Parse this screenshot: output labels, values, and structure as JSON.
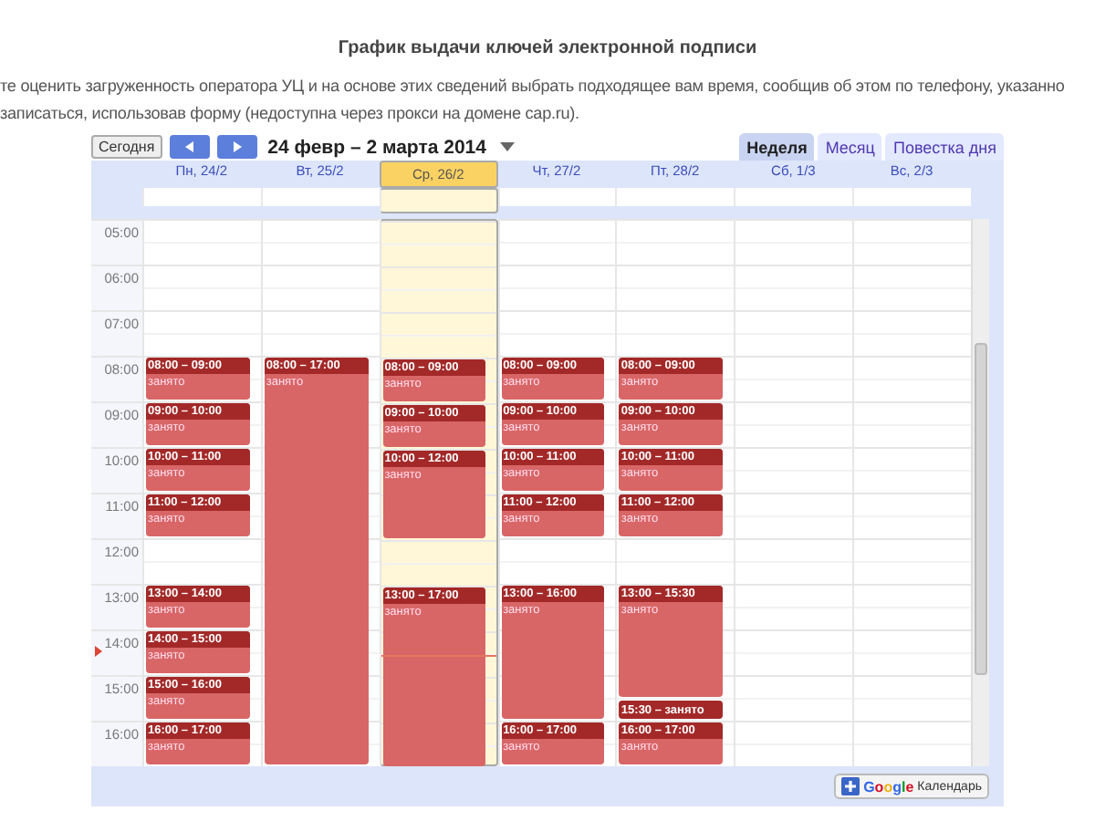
{
  "page": {
    "title": "График выдачи ключей электронной подписи",
    "paragraph_lines": [
      "те оценить загруженность оператора УЦ и на основе этих сведений выбрать подходящее вам время, сообщив об этом по телефону, указанно",
      "записаться, использовав форму (недоступна через прокси на домене cap.ru)."
    ]
  },
  "calendar": {
    "today_button": "Сегодня",
    "date_range": "24 февр – 2 марта 2014",
    "view_tabs": [
      {
        "label": "Неделя",
        "selected": true
      },
      {
        "label": "Месяц",
        "selected": false
      },
      {
        "label": "Повестка дня",
        "selected": false
      }
    ],
    "hours": [
      "05:00",
      "06:00",
      "07:00",
      "08:00",
      "09:00",
      "10:00",
      "11:00",
      "12:00",
      "13:00",
      "14:00",
      "15:00",
      "16:00"
    ],
    "days": [
      {
        "label": "Пн, 24/2",
        "selected": false,
        "events": [
          {
            "kind": "block",
            "time": "08:00 – 09:00",
            "title": "занято"
          },
          {
            "kind": "block",
            "time": "09:00 – 10:00",
            "title": "занято"
          },
          {
            "kind": "block",
            "time": "10:00 – 11:00",
            "title": "занято"
          },
          {
            "kind": "block",
            "time": "11:00 – 12:00",
            "title": "занято"
          },
          {
            "kind": "block",
            "time": "13:00 – 14:00",
            "title": "занято"
          },
          {
            "kind": "block",
            "time": "14:00 – 15:00",
            "title": "занято"
          },
          {
            "kind": "block",
            "time": "15:00 – 16:00",
            "title": "занято"
          },
          {
            "kind": "block",
            "time": "16:00 – 17:00",
            "title": "занято"
          }
        ]
      },
      {
        "label": "Вт, 25/2",
        "selected": false,
        "events": [
          {
            "kind": "block",
            "time": "08:00 – 17:00",
            "title": "занято"
          }
        ]
      },
      {
        "label": "Ср, 26/2",
        "selected": true,
        "events": [
          {
            "kind": "block",
            "time": "08:00 – 09:00",
            "title": "занято"
          },
          {
            "kind": "block",
            "time": "09:00 – 10:00",
            "title": "занято"
          },
          {
            "kind": "block",
            "time": "10:00 – 12:00",
            "title": "занято"
          },
          {
            "kind": "block",
            "time": "13:00 – 17:00",
            "title": "занято"
          }
        ]
      },
      {
        "label": "Чт, 27/2",
        "selected": false,
        "events": [
          {
            "kind": "block",
            "time": "08:00 – 09:00",
            "title": "занято"
          },
          {
            "kind": "block",
            "time": "09:00 – 10:00",
            "title": "занято"
          },
          {
            "kind": "block",
            "time": "10:00 – 11:00",
            "title": "занято"
          },
          {
            "kind": "block",
            "time": "11:00 – 12:00",
            "title": "занято"
          },
          {
            "kind": "block",
            "time": "13:00 – 16:00",
            "title": "занято"
          },
          {
            "kind": "block",
            "time": "16:00 – 17:00",
            "title": "занято"
          }
        ]
      },
      {
        "label": "Пт, 28/2",
        "selected": false,
        "events": [
          {
            "kind": "block",
            "time": "08:00 – 09:00",
            "title": "занято"
          },
          {
            "kind": "block",
            "time": "09:00 – 10:00",
            "title": "занято"
          },
          {
            "kind": "block",
            "time": "10:00 – 11:00",
            "title": "занято"
          },
          {
            "kind": "block",
            "time": "11:00 – 12:00",
            "title": "занято"
          },
          {
            "kind": "block",
            "time": "13:00 – 15:30",
            "title": "занято"
          },
          {
            "kind": "compact",
            "time": "15:30 –",
            "title": "занято"
          },
          {
            "kind": "block",
            "time": "16:00 – 17:00",
            "title": "занято"
          }
        ]
      },
      {
        "label": "Сб, 1/3",
        "selected": false
      },
      {
        "label": "Вс, 2/3",
        "selected": false
      }
    ],
    "footer_badge": {
      "logo": "Google",
      "label": "Календарь"
    }
  }
}
